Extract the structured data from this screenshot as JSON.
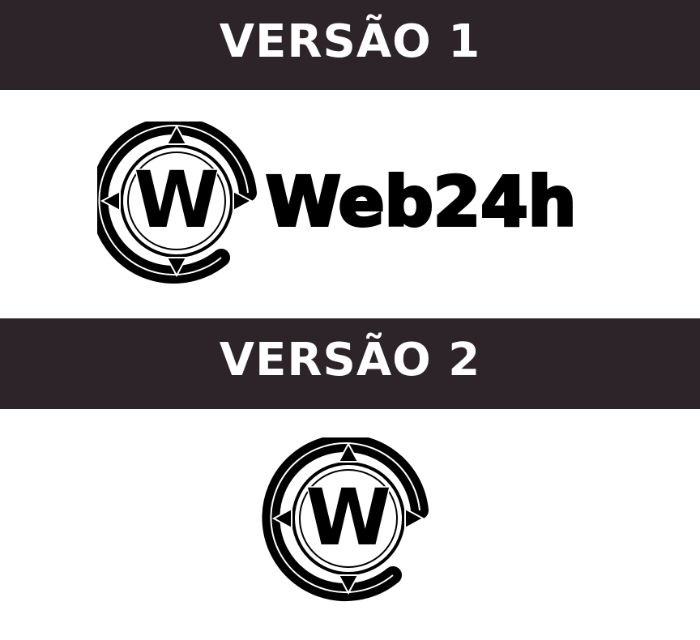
{
  "sections": [
    {
      "banner_title": "VERSÃO 1",
      "logo": {
        "mark_letter": "W",
        "wordmark": "Web24h"
      }
    },
    {
      "banner_title": "VERSÃO 2",
      "logo": {
        "mark_letter": "W"
      }
    }
  ],
  "colors": {
    "banner_background": "#2c2429",
    "banner_text": "#ffffff",
    "logo": "#000000",
    "background": "#ffffff"
  },
  "icons": [
    "at-sign-compass-logo-icon"
  ]
}
